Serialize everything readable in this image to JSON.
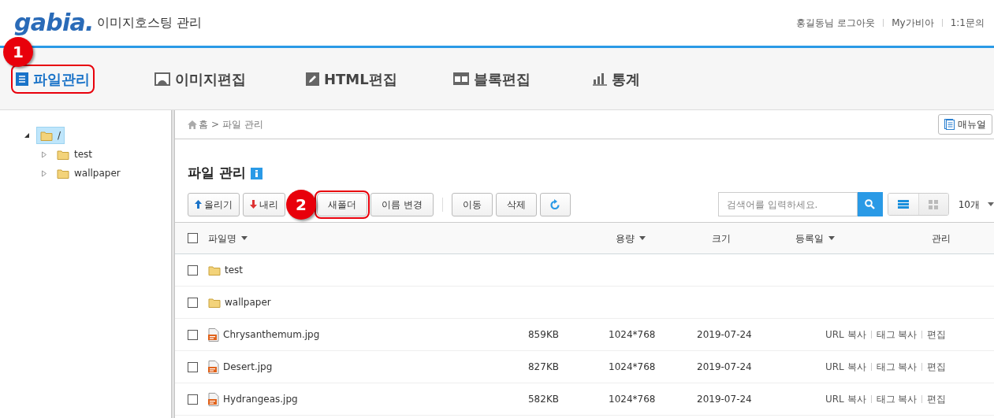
{
  "header": {
    "logo": "gabia.",
    "title": "이미지호스팅 관리",
    "links": [
      "홍길동님 로그아웃",
      "My가비아",
      "1:1문의"
    ]
  },
  "nav": [
    {
      "label": "파일관리",
      "selected": true,
      "callout": "1"
    },
    {
      "label": "이미지편집",
      "selected": false
    },
    {
      "label": "HTML편집",
      "selected": false
    },
    {
      "label": "블록편집",
      "selected": false
    },
    {
      "label": "통계",
      "selected": false
    }
  ],
  "tree": {
    "label": "/",
    "expanded": true,
    "selected": true,
    "children": [
      {
        "label": "test",
        "expanded": false
      },
      {
        "label": "wallpaper",
        "expanded": false
      }
    ]
  },
  "breadcrumb": [
    "홈",
    "파일 관리"
  ],
  "breadcrumb_separator": ">",
  "manual_button": "매뉴얼",
  "page_title": "파일 관리",
  "toolbar": [
    {
      "label": "올리기",
      "kind": "upload"
    },
    {
      "label": "내리",
      "kind": "download"
    },
    {
      "label": "새폴더",
      "kind": "text",
      "callout": "2"
    },
    {
      "label": "이름 변경",
      "kind": "text"
    },
    {
      "label": "이동",
      "kind": "text",
      "group_start": true
    },
    {
      "label": "삭제",
      "kind": "text"
    },
    {
      "kind": "refresh"
    }
  ],
  "search": {
    "placeholder": "검색어를 입력하세요."
  },
  "views": [
    {
      "kind": "list",
      "selected": true
    },
    {
      "kind": "grid",
      "selected": false
    }
  ],
  "page_size": "10개",
  "table": {
    "select_all": {
      "checked": false
    },
    "columns": [
      {
        "label": "파일명",
        "sortable": true
      },
      {
        "label": "용량",
        "sortable": true
      },
      {
        "label": "크기",
        "sortable": false
      },
      {
        "label": "등록일",
        "sortable": true
      },
      {
        "label": "관리",
        "sortable": false
      }
    ],
    "rows": [
      {
        "kind": "folder",
        "name": "test",
        "checked": false
      },
      {
        "kind": "folder",
        "name": "wallpaper",
        "checked": false
      },
      {
        "kind": "file",
        "name": "Chrysanthemum.jpg",
        "size": "859KB",
        "dimensions": "1024*768",
        "date": "2019-07-24",
        "actions": [
          "URL 복사",
          "태그 복사",
          "편집"
        ],
        "checked": false
      },
      {
        "kind": "file",
        "name": "Desert.jpg",
        "size": "827KB",
        "dimensions": "1024*768",
        "date": "2019-07-24",
        "actions": [
          "URL 복사",
          "태그 복사",
          "편집"
        ],
        "checked": false
      },
      {
        "kind": "file",
        "name": "Hydrangeas.jpg",
        "size": "582KB",
        "dimensions": "1024*768",
        "date": "2019-07-24",
        "actions": [
          "URL 복사",
          "태그 복사",
          "편집"
        ],
        "checked": false
      }
    ]
  }
}
